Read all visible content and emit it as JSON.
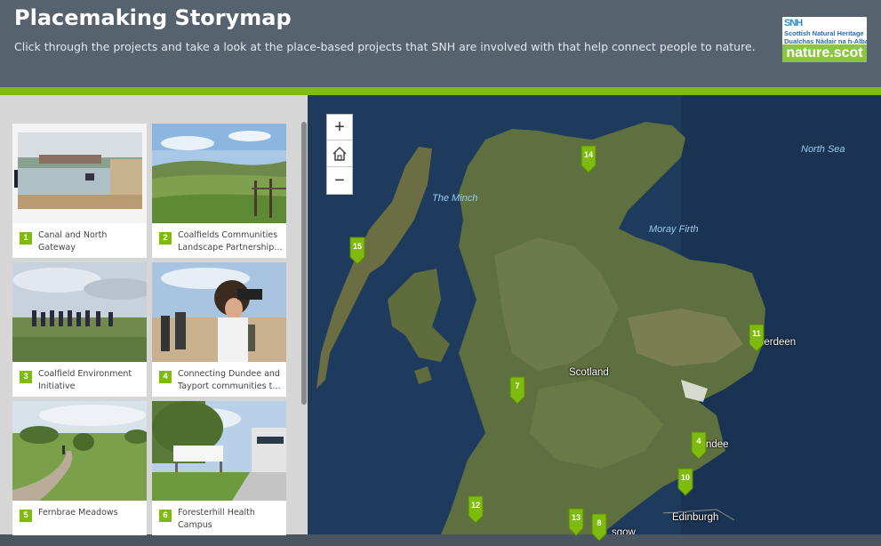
{
  "header": {
    "title": "Placemaking Storymap",
    "subtitle": "Click through the projects and take a look at the place-based projects that SNH are involved with that help connect people to nature.",
    "logo": {
      "line1": "SNH",
      "line2": "Scottish Natural Heritage",
      "line3": "Dualchas Nàdair na h-Alba",
      "line4": "nature.scot"
    }
  },
  "colors": {
    "header_bg": "#56626d",
    "accent_green": "#7fba0f",
    "sidebar_bg": "#d6d6d6",
    "sea": "#1e3a5c",
    "land": "#5e7040"
  },
  "cards": [
    {
      "num": "1",
      "label": "Canal and North Gateway"
    },
    {
      "num": "2",
      "label": "Coalfields Communities Landscape Partnership…"
    },
    {
      "num": "3",
      "label": "Coalfield Environment Initiative"
    },
    {
      "num": "4",
      "label": "Connecting Dundee and Tayport communities t…"
    },
    {
      "num": "5",
      "label": "Fernbrae Meadows"
    },
    {
      "num": "6",
      "label": "Foresterhill Health Campus"
    }
  ],
  "map": {
    "zoom_in": "+",
    "zoom_out": "−",
    "home_icon": "home-icon",
    "labels": {
      "north_sea": "North Sea",
      "the_minch": "The Minch",
      "moray_firth": "Moray Firth",
      "scotland": "Scotland",
      "aberdeen": "berdeen",
      "dundee": "ndee",
      "edinburgh": "Edinburgh",
      "glasgow": "sgow"
    },
    "pins": [
      "14",
      "15",
      "11",
      "7",
      "4",
      "10",
      "12",
      "13",
      "8"
    ]
  }
}
